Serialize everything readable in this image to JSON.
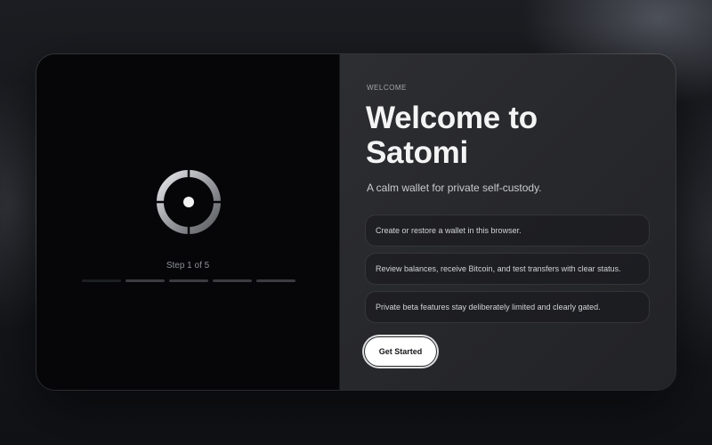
{
  "wizard": {
    "step_label": "Step 1 of 5",
    "total_steps": 5,
    "current_step": 1
  },
  "welcome": {
    "eyebrow": "WELCOME",
    "title": "Welcome to Satomi",
    "subtitle": "A calm wallet for private self-custody.",
    "features": [
      {
        "text": "Create or restore a wallet in this browser."
      },
      {
        "text": "Review balances, receive Bitcoin, and test transfers with clear status."
      },
      {
        "text": "Private beta features stay deliberately limited and clearly gated."
      }
    ],
    "cta_label": "Get Started"
  },
  "icons": {
    "loader": "spinner-ring-icon"
  }
}
